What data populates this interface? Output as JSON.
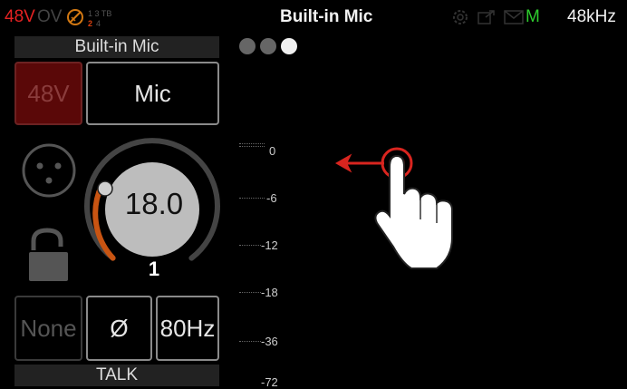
{
  "status_bar": {
    "phantom_48v": "48V",
    "ov": "OV",
    "mini_top": "1 3 TB",
    "mini_bottom_a": "2",
    "mini_bottom_b": "4",
    "title": "Built-in Mic",
    "m_indicator": "M",
    "sample_rate": "48kHz"
  },
  "channel": {
    "name": "Built-in Mic",
    "phantom_button": "48V",
    "input_type_button": "Mic",
    "gain_value": "18.0",
    "channel_number": "1",
    "routing_button": "None",
    "phase_button": "Ø",
    "hpf_button": "80Hz",
    "talk_label": "TALK"
  },
  "meter_scale": [
    "0",
    "-6",
    "-12",
    "-18",
    "-36",
    "-72"
  ],
  "page_dots": 3,
  "colors": {
    "phantom_red": "#e52222",
    "gain_arc": "#c85412",
    "m_green": "#2ecc2e",
    "swipe_arrow": "#d9251f"
  }
}
